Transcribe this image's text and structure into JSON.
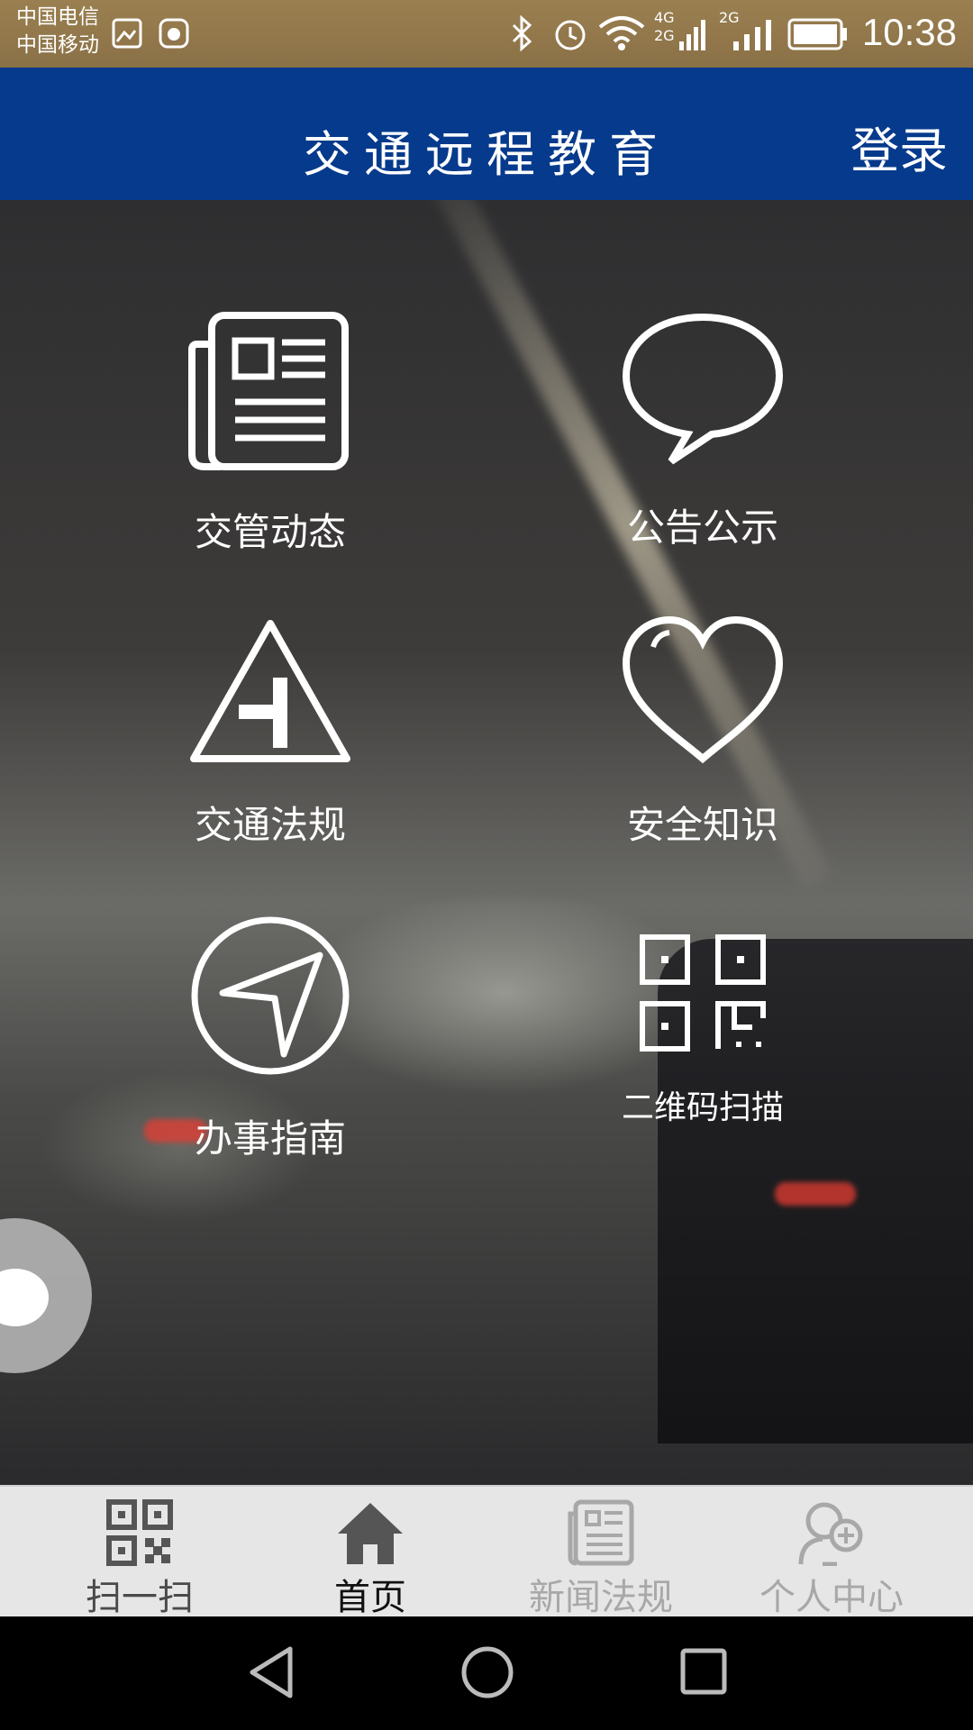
{
  "status_bar": {
    "carrier_1": "中国电信",
    "carrier_2": "中国移动",
    "network_1": "4G",
    "network_2": "2G",
    "network_3": "2G",
    "time": "10:38"
  },
  "header": {
    "title": "交通远程教育",
    "login_label": "登录"
  },
  "menu": {
    "items": [
      {
        "label": "交管动态",
        "icon": "newspaper-icon"
      },
      {
        "label": "公告公示",
        "icon": "speech-bubble-icon"
      },
      {
        "label": "交通法规",
        "icon": "traffic-sign-icon"
      },
      {
        "label": "安全知识",
        "icon": "heart-icon"
      },
      {
        "label": "办事指南",
        "icon": "compass-icon"
      },
      {
        "label": "二维码扫描",
        "icon": "qr-code-icon"
      }
    ]
  },
  "tabs": [
    {
      "label": "扫一扫",
      "icon": "qr-code-icon",
      "color": "#4a4a4a"
    },
    {
      "label": "首页",
      "icon": "home-icon",
      "color": "#111111"
    },
    {
      "label": "新闻法规",
      "icon": "newspaper-icon",
      "color": "#a8a8a8"
    },
    {
      "label": "个人中心",
      "icon": "user-add-icon",
      "color": "#a8a8a8"
    }
  ],
  "colors": {
    "header_bg": "#063a8c",
    "status_bar_bg": "#9a8050",
    "tab_bar_bg": "#e6e6e6"
  }
}
